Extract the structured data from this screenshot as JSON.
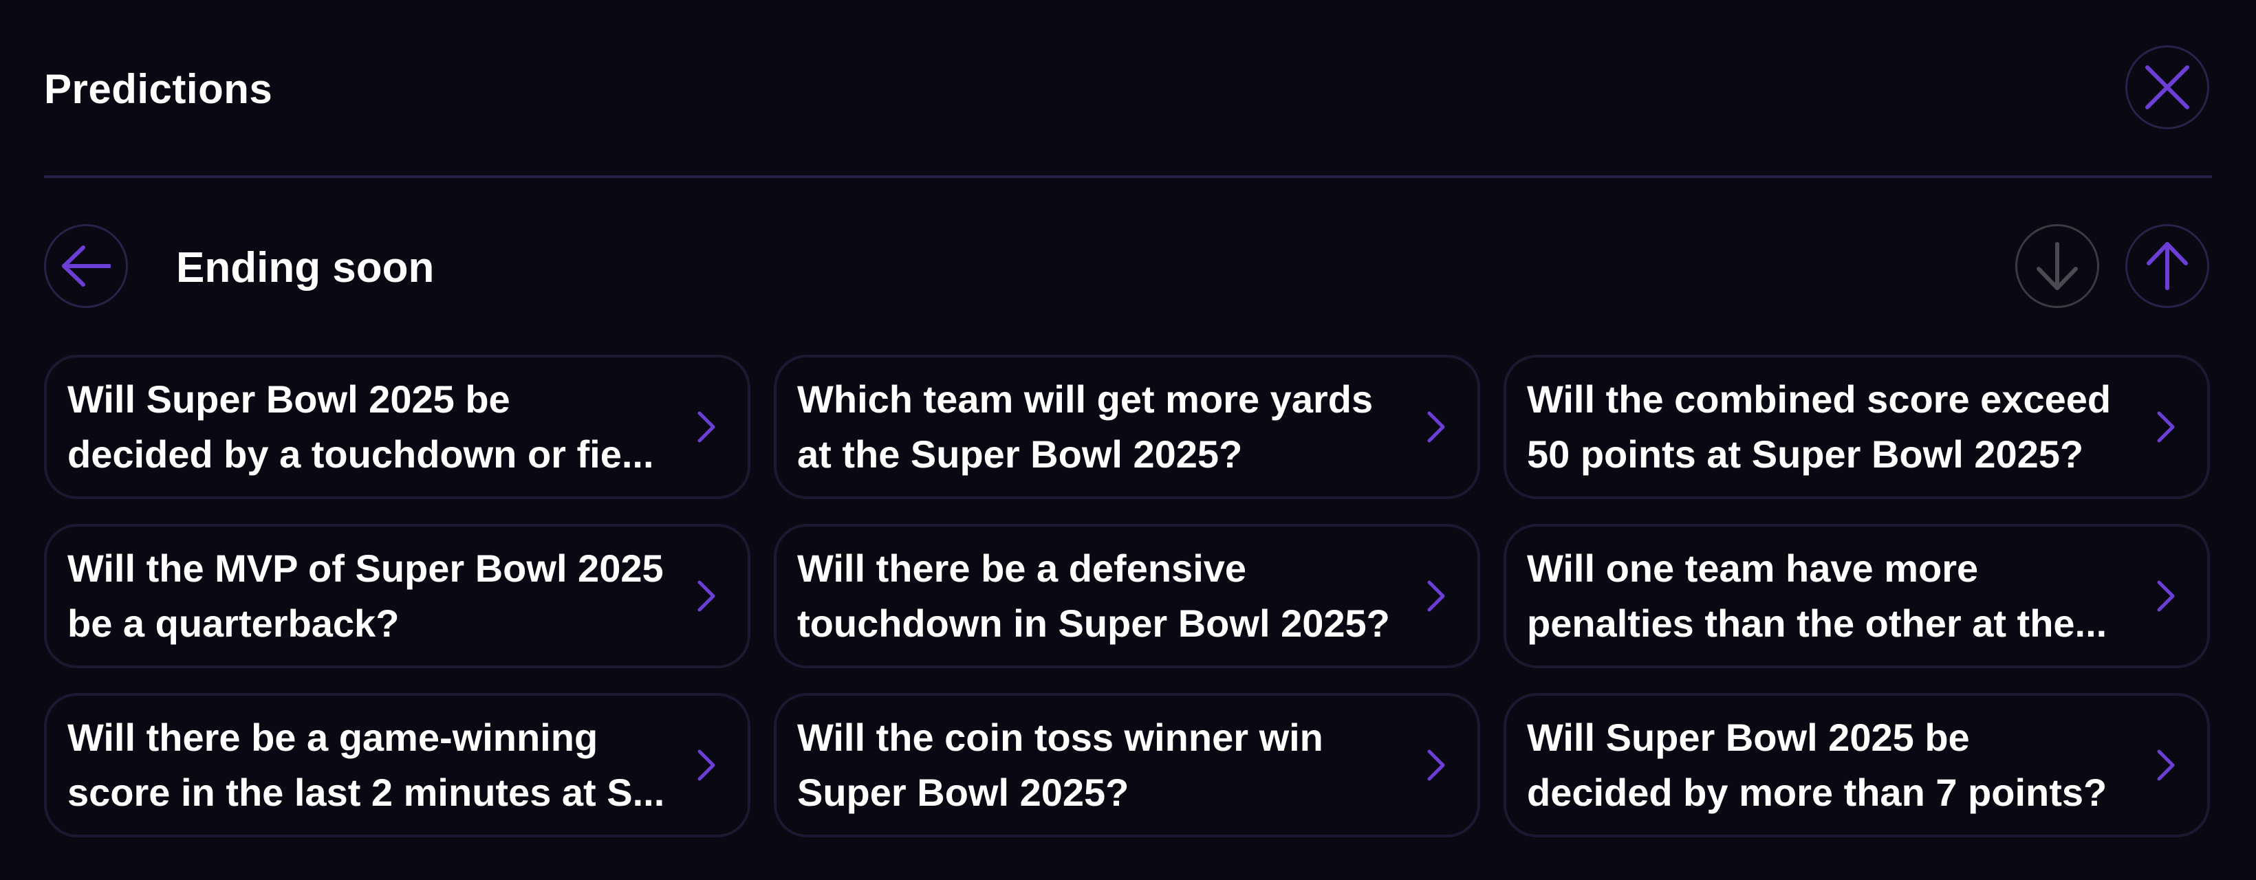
{
  "header": {
    "title": "Predictions",
    "close_icon": "close-icon"
  },
  "section": {
    "title": "Ending soon",
    "back_icon": "arrow-left-icon",
    "down_icon": "arrow-down-icon",
    "up_icon": "arrow-up-icon"
  },
  "colors": {
    "background": "#0a0812",
    "accent": "#6b3fd6",
    "border": "#2a2149",
    "disabled": "#4a4a50"
  },
  "predictions": [
    {
      "text": "Will Super Bowl 2025 be decided by a touchdown or fie..."
    },
    {
      "text": "Which team will get more yards at the Super Bowl 2025?"
    },
    {
      "text": "Will the combined score exceed 50 points at Super Bowl 2025?"
    },
    {
      "text": "Will the MVP of Super Bowl 2025 be a quarterback?"
    },
    {
      "text": "Will there be a defensive touchdown in Super Bowl 2025?"
    },
    {
      "text": "Will one team have more penalties than the other at the..."
    },
    {
      "text": "Will there be a game-winning score in the last 2 minutes at S..."
    },
    {
      "text": "Will the coin toss winner win Super Bowl 2025?"
    },
    {
      "text": "Will Super Bowl 2025 be decided by more than 7 points?"
    }
  ]
}
